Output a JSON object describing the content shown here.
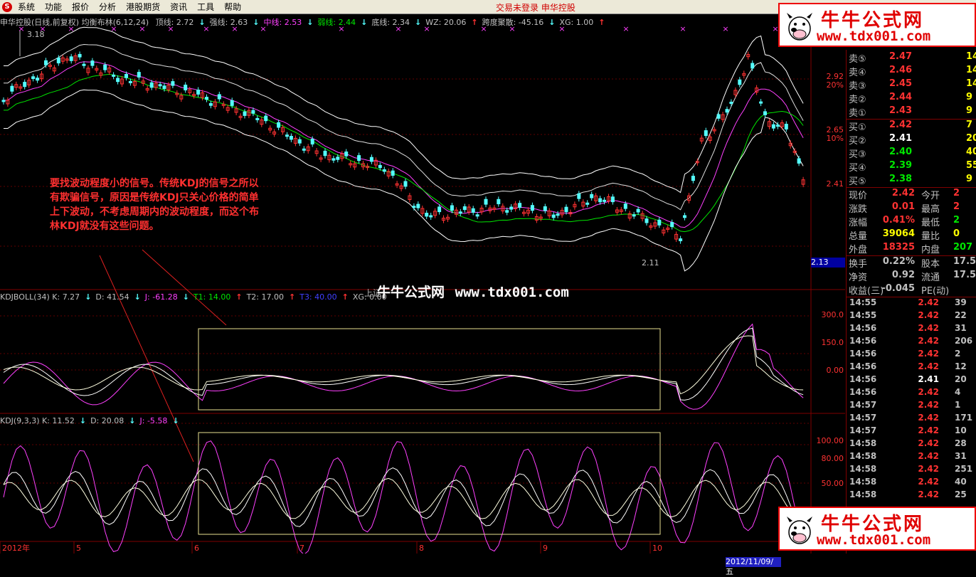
{
  "menu": {
    "logo": "S",
    "items": [
      "系统",
      "功能",
      "报价",
      "分析",
      "港股期货",
      "资讯",
      "工具",
      "帮助"
    ],
    "status": "交易未登录  申华控股"
  },
  "main_header": {
    "title": "申华控股(日线,前复权) 均衡布林(6,12,24)",
    "items": [
      {
        "text": "顶线: 2.72",
        "arrow": "↓",
        "color": "#c0c0c0"
      },
      {
        "text": "强线: 2.63",
        "arrow": "↓",
        "color": "#c0c0c0"
      },
      {
        "text": "中线: 2.53",
        "arrow": "↓",
        "color": "#ff40ff"
      },
      {
        "text": "弱线: 2.44",
        "arrow": "↓",
        "color": "#00e600"
      },
      {
        "text": "底线: 2.34",
        "arrow": "↓",
        "color": "#c0c0c0"
      },
      {
        "text": "WZ: 20.06",
        "arrow": "↑",
        "color": "#c0c0c0"
      },
      {
        "text": "跨度聚散: -45.16",
        "arrow": "↓",
        "color": "#c0c0c0"
      },
      {
        "text": "XG: 1.00",
        "arrow": "↑",
        "color": "#c0c0c0"
      }
    ]
  },
  "kdjboll_header": {
    "items": [
      {
        "text": "KDJBOLL(34) K: 7.27",
        "arrow": "↓",
        "color": "#c0c0c0"
      },
      {
        "text": "D: 41.54",
        "arrow": "↓",
        "color": "#c0c0c0"
      },
      {
        "text": "J: -61.28",
        "arrow": "↓",
        "color": "#ff40ff"
      },
      {
        "text": "T1: 14.00",
        "arrow": "↑",
        "color": "#00e600"
      },
      {
        "text": "T2: 17.00",
        "arrow": "↑",
        "color": "#c0c0c0"
      },
      {
        "text": "T3: 40.00",
        "arrow": "↑",
        "color": "#4040ff"
      },
      {
        "text": "XG: 0.00",
        "arrow": "",
        "color": "#c0c0c0"
      }
    ]
  },
  "kdj_header": {
    "items": [
      {
        "text": "KDJ(9,3,3) K: 11.52",
        "arrow": "↓",
        "color": "#c0c0c0"
      },
      {
        "text": "D: 20.08",
        "arrow": "↓",
        "color": "#c0c0c0"
      },
      {
        "text": "J: -5.58",
        "arrow": "↓",
        "color": "#ff40ff"
      }
    ]
  },
  "price_axis": [
    {
      "label": "2.92",
      "pct": "20%"
    },
    {
      "label": "2.65",
      "pct": "10%"
    },
    {
      "label": "2.41",
      "pct": ""
    }
  ],
  "current_price_box": "2.13",
  "kdjboll_axis": [
    "300.0",
    "150.0",
    "0.00"
  ],
  "kdj_axis": [
    "100.00",
    "80.00",
    "50.00"
  ],
  "date_axis": [
    "2012年",
    "5",
    "6",
    "7",
    "8",
    "9",
    "10"
  ],
  "selected_date": "2012/11/09/五",
  "high_marker": "3.18",
  "low_marker": "2.11",
  "annotation": "要找波动程度小的信号。传统KDJ的信号之所以有欺骗信号，原因是传统KDJ只关心价格的简单上下波动，不考虑周期内的波动程度，而这个布林KDJ就没有这些问题。",
  "watermark": {
    "cn": "牛牛公式网",
    "url": "www.tdx001.com",
    "under": "上证"
  },
  "brand": {
    "cn": "牛牛公式网",
    "url": "www.tdx001.com"
  },
  "quote": {
    "sell": [
      {
        "label": "卖⑤",
        "price": "2.47",
        "vol": "14"
      },
      {
        "label": "卖④",
        "price": "2.46",
        "vol": "14"
      },
      {
        "label": "卖③",
        "price": "2.45",
        "vol": "14"
      },
      {
        "label": "卖②",
        "price": "2.44",
        "vol": "9"
      },
      {
        "label": "卖①",
        "price": "2.43",
        "vol": "9"
      }
    ],
    "buy": [
      {
        "label": "买①",
        "price": "2.42",
        "pcolor": "#ff3232",
        "vol": "7"
      },
      {
        "label": "买②",
        "price": "2.41",
        "pcolor": "#ffffff",
        "vol": "20"
      },
      {
        "label": "买③",
        "price": "2.40",
        "pcolor": "#00e600",
        "vol": "40"
      },
      {
        "label": "买④",
        "price": "2.39",
        "pcolor": "#00e600",
        "vol": "55"
      },
      {
        "label": "买⑤",
        "price": "2.38",
        "pcolor": "#00e600",
        "vol": "9"
      }
    ],
    "stats": [
      {
        "l1": "现价",
        "v1": "2.42",
        "c1": "#ff3232",
        "l2": "今开",
        "v2": "2",
        "c2": "#ff3232"
      },
      {
        "l1": "涨跌",
        "v1": "0.01",
        "c1": "#ff3232",
        "l2": "最高",
        "v2": "2",
        "c2": "#ff3232"
      },
      {
        "l1": "涨幅",
        "v1": "0.41%",
        "c1": "#ff3232",
        "l2": "最低",
        "v2": "2",
        "c2": "#00e600"
      },
      {
        "l1": "总量",
        "v1": "39064",
        "c1": "#ffff00",
        "l2": "量比",
        "v2": "0",
        "c2": "#ffff00"
      },
      {
        "l1": "外盘",
        "v1": "18325",
        "c1": "#ff3232",
        "l2": "内盘",
        "v2": "207",
        "c2": "#00e600"
      }
    ],
    "stats2": [
      {
        "l1": "换手",
        "v1": "0.22%",
        "c1": "#c0c0c0",
        "l2": "股本",
        "v2": "17.5",
        "c2": "#c0c0c0"
      },
      {
        "l1": "净资",
        "v1": "0.92",
        "c1": "#c0c0c0",
        "l2": "流通",
        "v2": "17.5",
        "c2": "#c0c0c0"
      },
      {
        "l1": "收益(三)",
        "v1": "-0.045",
        "c1": "#c0c0c0",
        "l2": "PE(动)",
        "v2": "",
        "c2": "#c0c0c0"
      }
    ],
    "ticks": [
      {
        "t": "14:55",
        "p": "2.42",
        "pc": "#ff3232",
        "v": "39"
      },
      {
        "t": "14:55",
        "p": "2.42",
        "pc": "#ff3232",
        "v": "22"
      },
      {
        "t": "14:56",
        "p": "2.42",
        "pc": "#ff3232",
        "v": "31"
      },
      {
        "t": "14:56",
        "p": "2.42",
        "pc": "#ff3232",
        "v": "206"
      },
      {
        "t": "14:56",
        "p": "2.42",
        "pc": "#ff3232",
        "v": "2"
      },
      {
        "t": "14:56",
        "p": "2.42",
        "pc": "#ff3232",
        "v": "12"
      },
      {
        "t": "14:56",
        "p": "2.41",
        "pc": "#ffffff",
        "v": "20"
      },
      {
        "t": "14:56",
        "p": "2.42",
        "pc": "#ff3232",
        "v": "4"
      },
      {
        "t": "14:57",
        "p": "2.42",
        "pc": "#ff3232",
        "v": "1"
      },
      {
        "t": "14:57",
        "p": "2.42",
        "pc": "#ff3232",
        "v": "171"
      },
      {
        "t": "14:57",
        "p": "2.42",
        "pc": "#ff3232",
        "v": "10"
      },
      {
        "t": "14:58",
        "p": "2.42",
        "pc": "#ff3232",
        "v": "28"
      },
      {
        "t": "14:58",
        "p": "2.42",
        "pc": "#ff3232",
        "v": "31"
      },
      {
        "t": "14:58",
        "p": "2.42",
        "pc": "#ff3232",
        "v": "251"
      },
      {
        "t": "14:58",
        "p": "2.42",
        "pc": "#ff3232",
        "v": "40"
      },
      {
        "t": "14:58",
        "p": "2.42",
        "pc": "#ff3232",
        "v": "25"
      }
    ]
  },
  "colors": {
    "up_candle": "#ff3232",
    "down_candle": "#54ffff",
    "band_outer": "#ffffff",
    "band_mid": "#ff40ff",
    "band_weak": "#00e600",
    "frame": "#800000",
    "highlight_box": "#e8e090"
  }
}
